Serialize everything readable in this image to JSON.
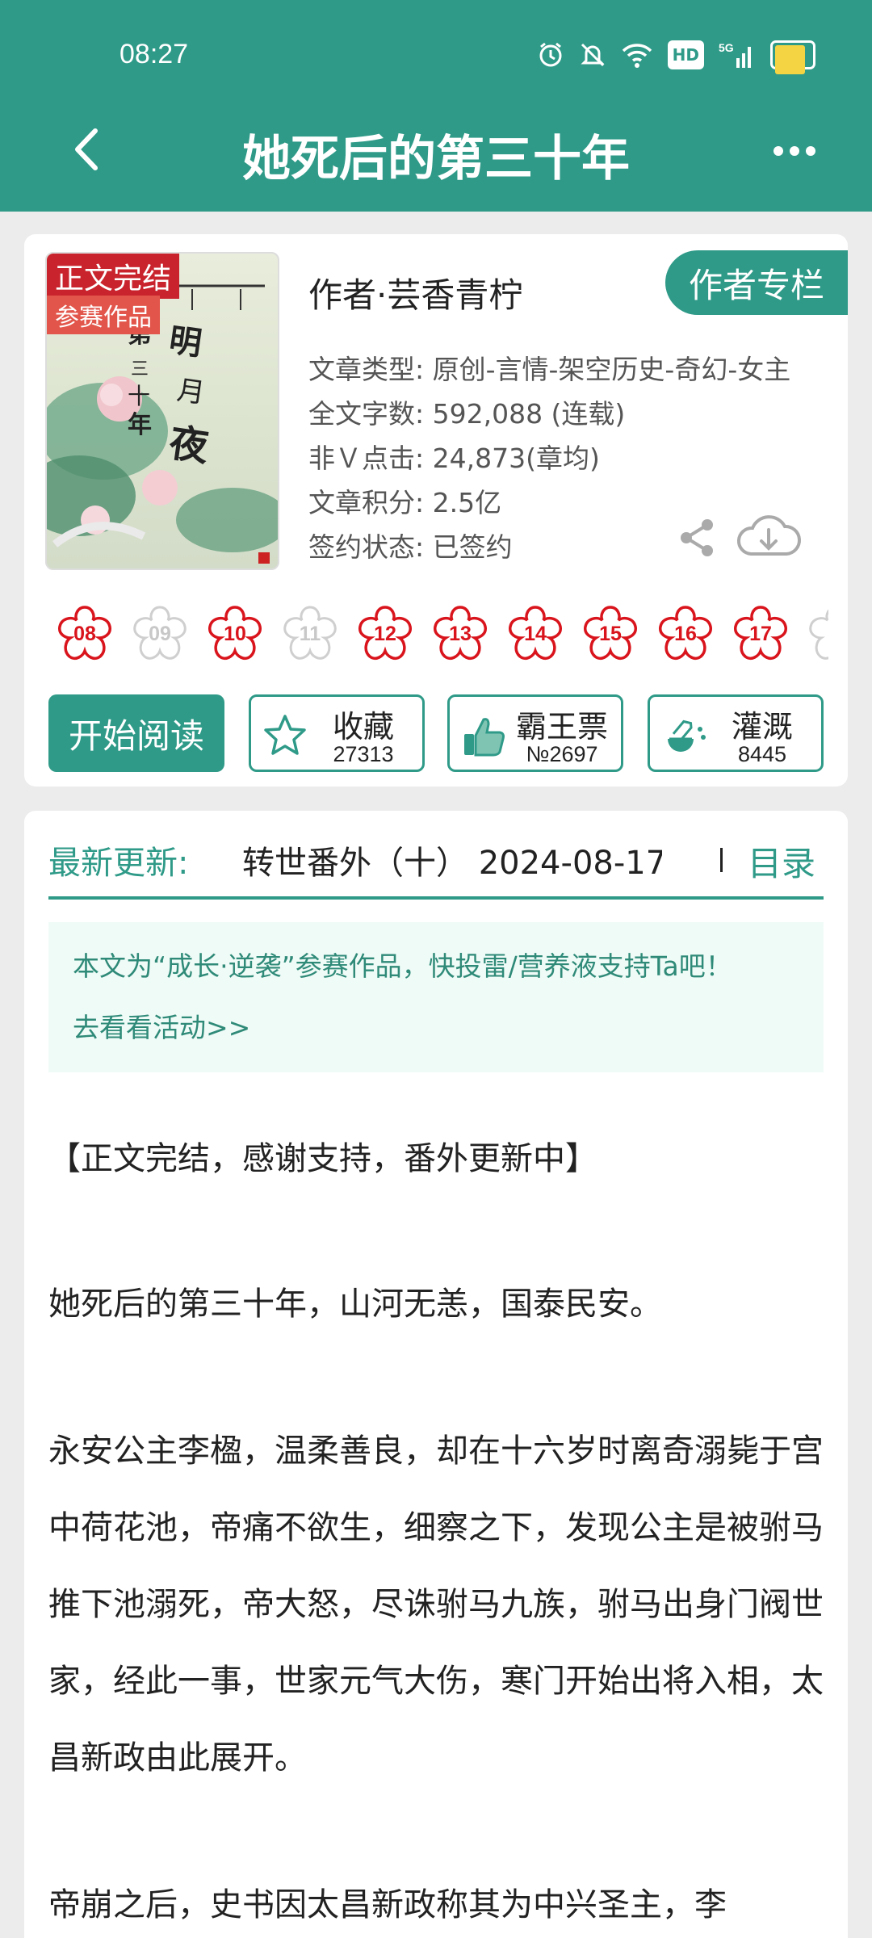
{
  "status_bar": {
    "time": "08:27",
    "icons": [
      "alarm-icon",
      "mute-icon",
      "wifi-icon",
      "hd-icon",
      "signal-5g-icon",
      "battery-icon"
    ],
    "hd_label": "HD",
    "network_label": "5G",
    "battery_level": 0.85
  },
  "header": {
    "title": "她死后的第三十年",
    "back_icon": "chevron-left-icon",
    "more_icon": "more-horizontal-icon"
  },
  "book": {
    "cover": {
      "tag_completed": "正文完结",
      "tag_contest": "参赛作品"
    },
    "author": "作者·芸香青柠",
    "author_column_button": "作者专栏",
    "meta": [
      "文章类型: 原创-言情-架空历史-奇幻-女主",
      "全文字数: 592,088 (连载)",
      "非Ｖ点击: 24,873(章均)",
      "文章积分: 2.5亿",
      "签约状态: 已签约"
    ],
    "flowers": [
      {
        "label": "08",
        "active": true
      },
      {
        "label": "09",
        "active": false
      },
      {
        "label": "10",
        "active": true
      },
      {
        "label": "11",
        "active": false
      },
      {
        "label": "12",
        "active": true
      },
      {
        "label": "13",
        "active": true
      },
      {
        "label": "14",
        "active": true
      },
      {
        "label": "15",
        "active": true
      },
      {
        "label": "16",
        "active": true
      },
      {
        "label": "17",
        "active": true
      },
      {
        "label": "",
        "active": false
      }
    ],
    "colors": {
      "accent": "#2f9a88",
      "flower_active": "#d9141c",
      "flower_inactive": "#cfcfcf"
    }
  },
  "actions": {
    "read": "开始阅读",
    "favorite": {
      "label": "收藏",
      "count": "27313",
      "icon": "star-icon"
    },
    "ticket": {
      "label": "霸王票",
      "count": "№2697",
      "icon": "thumbs-up-icon"
    },
    "nutrient": {
      "label": "灌溉",
      "count": "8445",
      "icon": "watering-flask-icon"
    }
  },
  "latest": {
    "label": "最新更新:",
    "chapter": "转世番外（十）   2024-08-17",
    "toc": "目录"
  },
  "notice": {
    "text": "本文为“成长·逆袭”参赛作品，快投雷/营养液支持Ta吧！",
    "link": "去看看活动>>"
  },
  "intro": [
    "【正文完结，感谢支持，番外更新中】",
    "她死后的第三十年，山河无恙，国泰民安。",
    "永安公主李楹，温柔善良，却在十六岁时离奇溺毙于宫中荷花池，帝痛不欲生，细察之下，发现公主是被驸马推下池溺死，帝大怒，尽诛驸马九族，驸马出身门阀世家，经此一事，世家元气大伤，寒门开始出将入相，太昌新政由此展开。",
    "帝崩之后，史书因太昌新政称其为中兴圣主，李"
  ]
}
